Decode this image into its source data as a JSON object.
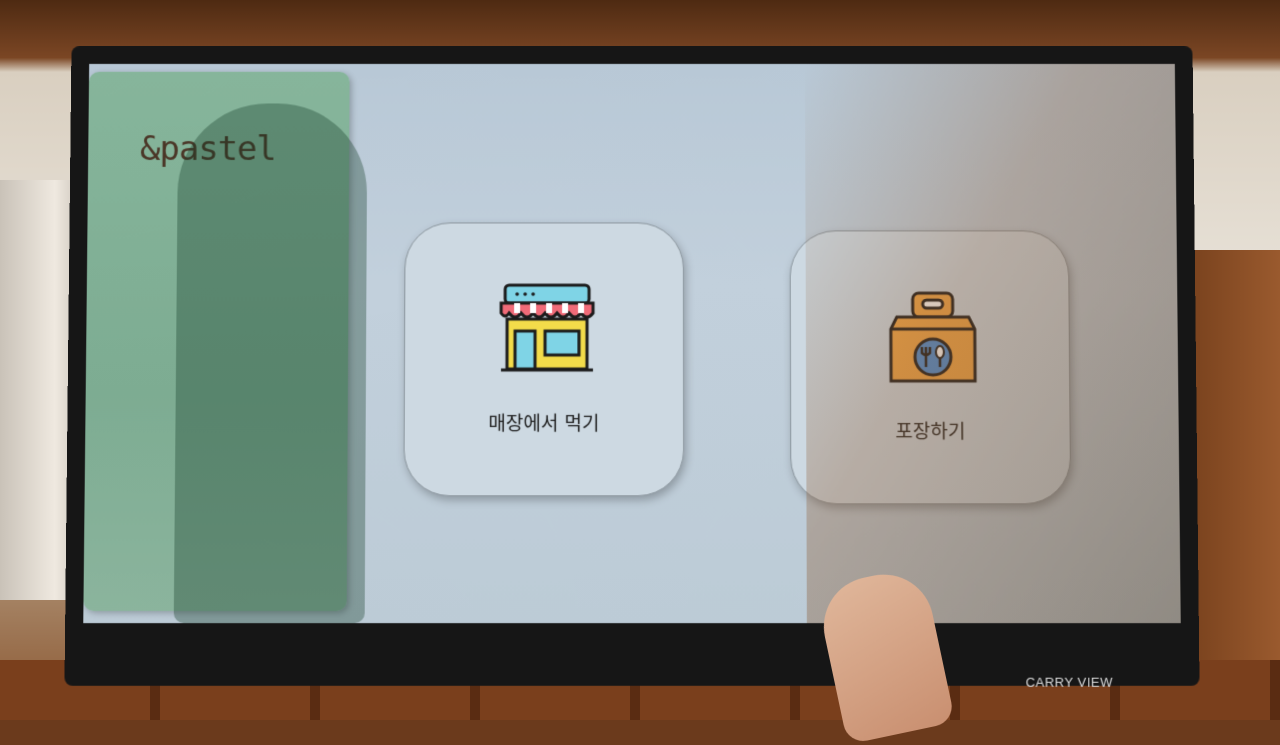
{
  "kiosk": {
    "logo": "&pastel",
    "options": [
      {
        "label": "매장에서 먹기",
        "icon": "store-icon"
      },
      {
        "label": "포장하기",
        "icon": "takeout-bag-icon"
      }
    ]
  },
  "monitor": {
    "brand": "CARRY VIEW"
  }
}
